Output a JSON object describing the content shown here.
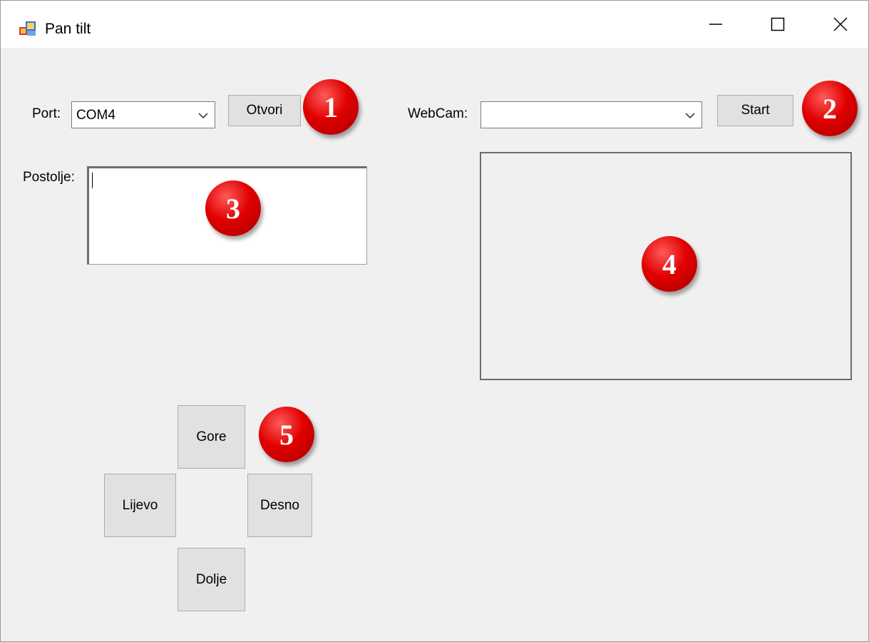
{
  "window": {
    "title": "Pan tilt",
    "icon": "winforms-app-icon",
    "controls": [
      "minimize-icon",
      "maximize-icon",
      "close-icon"
    ]
  },
  "port": {
    "label": "Port:",
    "selected": "COM4",
    "open_button": "Otvori"
  },
  "webcam": {
    "label": "WebCam:",
    "selected": "",
    "start_button": "Start"
  },
  "postolje": {
    "label": "Postolje:",
    "value": ""
  },
  "direction_buttons": {
    "up": "Gore",
    "left": "Lijevo",
    "right": "Desno",
    "down": "Dolje"
  },
  "markers": [
    "1",
    "2",
    "3",
    "4",
    "5"
  ],
  "colors": {
    "window_bg": "#f0f0f0",
    "titlebar_bg": "#ffffff",
    "button_bg": "#e1e1e1",
    "marker_red": "#e00000"
  }
}
